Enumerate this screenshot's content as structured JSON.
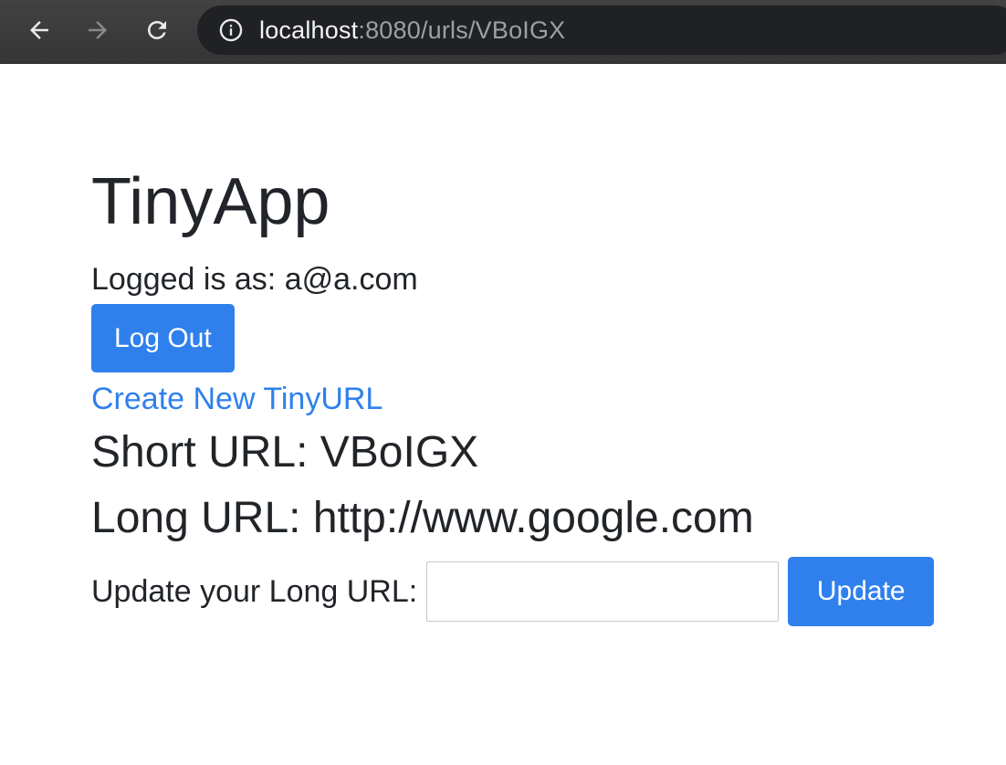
{
  "browser": {
    "url_host": "localhost",
    "url_rest": ":8080/urls/VBoIGX",
    "icons": {
      "back": "arrow-left-icon",
      "forward": "arrow-right-icon",
      "reload": "reload-icon",
      "info": "info-icon"
    }
  },
  "page": {
    "title": "TinyApp",
    "logged_in_text": "Logged is as: a@a.com",
    "logout_label": "Log Out",
    "create_link_label": "Create New TinyURL",
    "short_url_text": "Short URL: VBoIGX",
    "long_url_text": "Long URL: http://www.google.com",
    "update_label": "Update your Long URL:",
    "update_input_value": "",
    "update_input_placeholder": "",
    "update_button_label": "Update"
  },
  "colors": {
    "primary": "#2f80ed",
    "text": "#212529",
    "toolbar": "#3c3c3c",
    "omnibox": "#202124"
  }
}
